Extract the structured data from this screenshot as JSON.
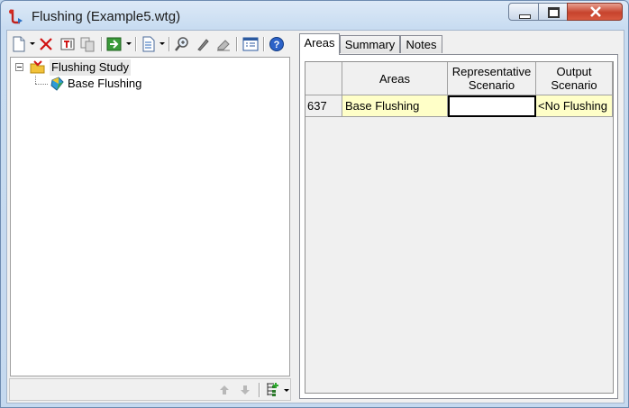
{
  "window": {
    "title": "Flushing (Example5.wtg)"
  },
  "tree": {
    "root": {
      "label": "Flushing Study",
      "expander": "⊟"
    },
    "child": {
      "label": "Base Flushing"
    }
  },
  "tabs": [
    {
      "label": "Areas",
      "active": true
    },
    {
      "label": "Summary",
      "active": false
    },
    {
      "label": "Notes",
      "active": false
    }
  ],
  "grid": {
    "columns": [
      "Areas",
      "Representative Scenario",
      "Output Scenario"
    ],
    "rows": [
      {
        "id": "637",
        "area": "Base Flushing",
        "representative": "",
        "output": "<No Flushing"
      }
    ]
  },
  "icons": [
    "new-icon",
    "delete-icon",
    "rename-icon",
    "duplicate-icon",
    "compute-icon",
    "report-icon",
    "zoom-icon",
    "edit-icon",
    "erase-icon",
    "properties-icon",
    "help-icon",
    "move-up-icon",
    "move-down-icon",
    "tree-options-icon"
  ],
  "colors": {
    "selected_row": "#ffffc8",
    "title_bg": "#c8dcf1",
    "close_button": "#c7432d"
  }
}
